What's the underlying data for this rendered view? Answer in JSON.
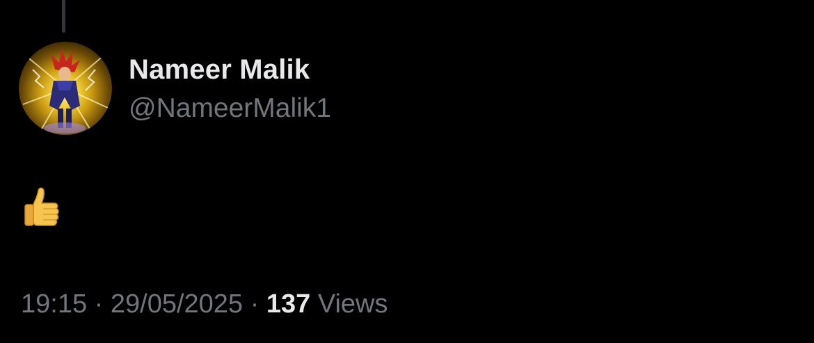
{
  "post": {
    "author": {
      "display_name": "Nameer Malik",
      "handle": "@NameerMalik1",
      "avatar_icon": "anime-character-avatar"
    },
    "content": {
      "emoji": "👍",
      "emoji_icon": "thumbs-up-icon"
    },
    "meta": {
      "time": "19:15",
      "separator": "·",
      "date": "29/05/2025",
      "views_count": "137",
      "views_label": "Views"
    }
  },
  "colors": {
    "background": "#000000",
    "primary_text": "#e7e9ea",
    "secondary_text": "#71767b",
    "thread_line": "#333639"
  }
}
